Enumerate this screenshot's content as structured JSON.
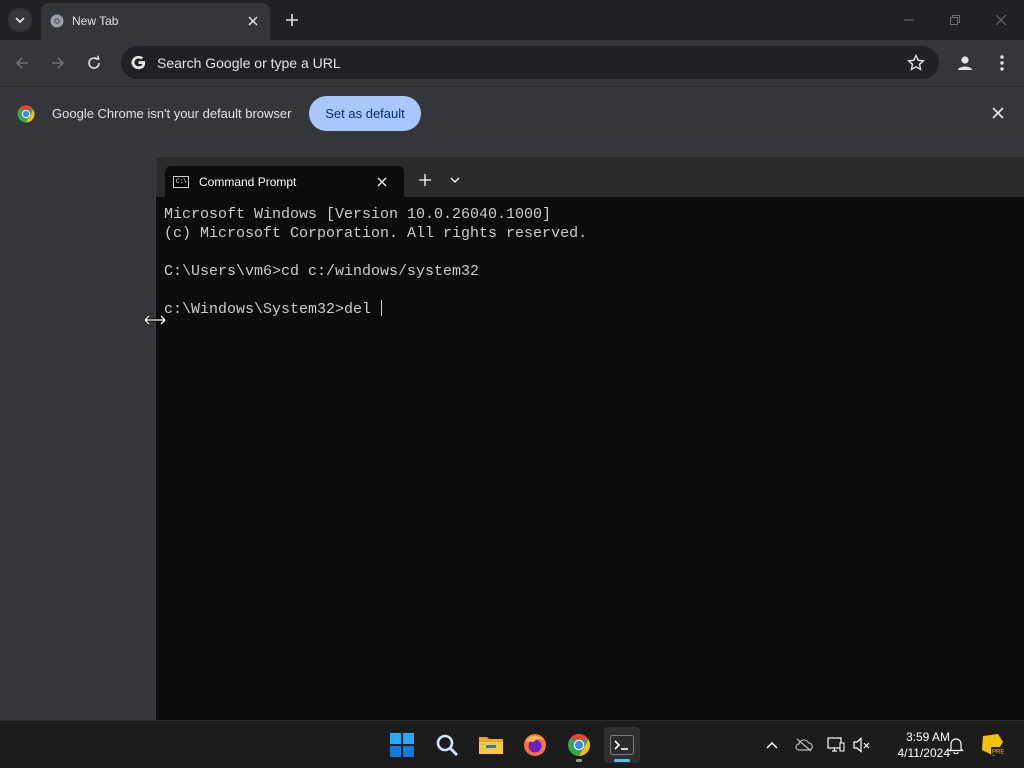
{
  "browser": {
    "tab_title": "New Tab",
    "omnibox_placeholder": "Search Google or type a URL",
    "infobar_message": "Google Chrome isn't your default browser",
    "set_default_label": "Set as default",
    "accent_color": "#a8c7fa"
  },
  "terminal": {
    "tab_title": "Command Prompt",
    "tab_icon_text": "C:\\",
    "lines": [
      "Microsoft Windows [Version 10.0.26040.1000]",
      "(c) Microsoft Corporation. All rights reserved.",
      "",
      "C:\\Users\\vm6>cd c:/windows/system32",
      "",
      "c:\\Windows\\System32>del "
    ]
  },
  "taskbar": {
    "apps": [
      {
        "name": "start",
        "icon": "windows-logo-icon"
      },
      {
        "name": "search",
        "icon": "search-icon"
      },
      {
        "name": "file-explorer",
        "icon": "folder-icon"
      },
      {
        "name": "firefox",
        "icon": "firefox-icon"
      },
      {
        "name": "chrome",
        "icon": "chrome-icon"
      },
      {
        "name": "terminal",
        "icon": "terminal-icon",
        "active": true
      }
    ],
    "time": "3:59 AM",
    "date": "4/11/2024"
  }
}
